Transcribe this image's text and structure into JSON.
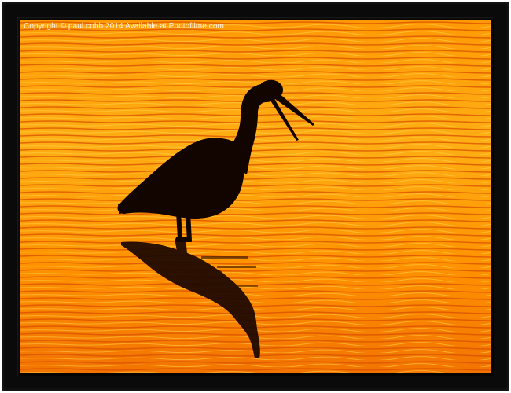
{
  "watermark": {
    "text": "Copyright © paul cobb 2014 Available at Photofilme.com"
  },
  "colors": {
    "frame": "#0a0a0a",
    "water_light": "#ffb21a",
    "water_mid": "#ff8a00",
    "water_dark": "#e85a00",
    "silhouette": "#120500"
  }
}
